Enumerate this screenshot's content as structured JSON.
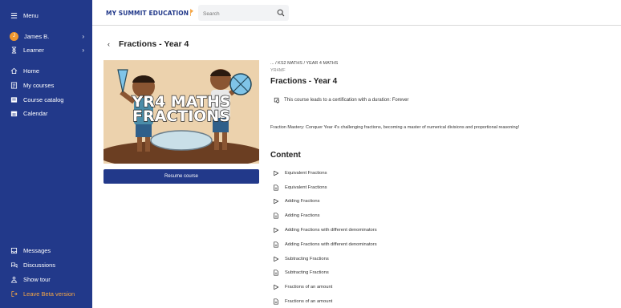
{
  "sidebar": {
    "menu_label": "Menu",
    "user": {
      "initial": "J",
      "name": "James B."
    },
    "role": "Learner",
    "nav": [
      {
        "label": "Home",
        "icon": "home-icon"
      },
      {
        "label": "My courses",
        "icon": "list-icon"
      },
      {
        "label": "Course catalog",
        "icon": "catalog-icon"
      },
      {
        "label": "Calendar",
        "icon": "calendar-icon"
      }
    ],
    "bottom": [
      {
        "label": "Messages",
        "icon": "message-icon"
      },
      {
        "label": "Discussions",
        "icon": "discussion-icon"
      },
      {
        "label": "Show tour",
        "icon": "tour-icon"
      },
      {
        "label": "Leave Beta version",
        "icon": "leave-beta-icon"
      }
    ]
  },
  "header": {
    "logo": "MY SUMMIT EDUCATION",
    "search_placeholder": "Search"
  },
  "page": {
    "title": "Fractions - Year 4",
    "hero_text_line1": "YR4 MATHS",
    "hero_text_line2": "FRACTIONS",
    "resume_label": "Resume course"
  },
  "course": {
    "breadcrumb": "... / KS2 MATHS / YEAR 4 MATHS",
    "code": "YR4MF",
    "title": "Fractions - Year 4",
    "certification": "This course leads to a certification with a duration: Forever",
    "description": "Fraction Mastery: Conquer Year 4's challenging fractions, becoming a master of numerical divisions and proportional reasoning!",
    "content_heading": "Content"
  },
  "content_items": [
    {
      "label": "Equivalent Fractions",
      "type": "video"
    },
    {
      "label": "Equivalent Fractions",
      "type": "document"
    },
    {
      "label": "Adding Fractions",
      "type": "video"
    },
    {
      "label": "Adding Fractions",
      "type": "document"
    },
    {
      "label": "Adding Fractions with different denominators",
      "type": "video"
    },
    {
      "label": "Adding Fractions with different denominators",
      "type": "document"
    },
    {
      "label": "Subtracting Fractions",
      "type": "video"
    },
    {
      "label": "Subtracting Fractions",
      "type": "document"
    },
    {
      "label": "Fractions of an amount",
      "type": "video"
    },
    {
      "label": "Fractions of an amount",
      "type": "document"
    }
  ],
  "colors": {
    "brand": "#22398a",
    "accent": "#f5a645",
    "avatar": "#f0972f"
  }
}
